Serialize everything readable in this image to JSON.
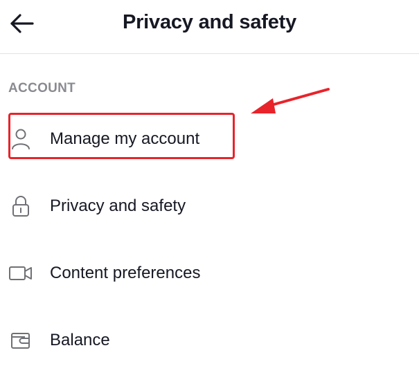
{
  "header": {
    "title": "Privacy and safety",
    "back_icon": "arrow-left-icon"
  },
  "section": {
    "label": "ACCOUNT"
  },
  "menu": [
    {
      "label": "Manage my account",
      "icon": "person-icon"
    },
    {
      "label": "Privacy and safety",
      "icon": "lock-icon"
    },
    {
      "label": "Content preferences",
      "icon": "video-icon"
    },
    {
      "label": "Balance",
      "icon": "wallet-icon"
    }
  ],
  "annotation": {
    "color": "#e8232a"
  }
}
